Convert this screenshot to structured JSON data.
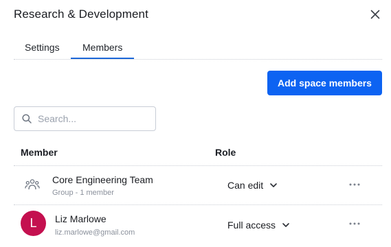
{
  "header": {
    "title": "Research & Development"
  },
  "tabs": [
    {
      "label": "Settings"
    },
    {
      "label": "Members",
      "active": true
    }
  ],
  "actions": {
    "add_members_label": "Add space members"
  },
  "search": {
    "placeholder": "Search..."
  },
  "table": {
    "columns": {
      "member": "Member",
      "role": "Role"
    },
    "rows": [
      {
        "name": "Core Engineering Team",
        "subtitle": "Group - 1 member",
        "role": "Can edit",
        "icon": "group-icon"
      },
      {
        "name": "Liz Marlowe",
        "subtitle": "liz.marlowe@gmail.com",
        "role": "Full access",
        "avatar_initial": "L"
      }
    ]
  },
  "colors": {
    "accent": "#0d63f2",
    "tab_underline": "#1c67d8",
    "avatar_bg": "#c4104f"
  },
  "icons": {
    "close": "close-icon",
    "search": "search-icon",
    "chevron": "chevron-down-icon",
    "more": "more-horizontal-icon"
  }
}
